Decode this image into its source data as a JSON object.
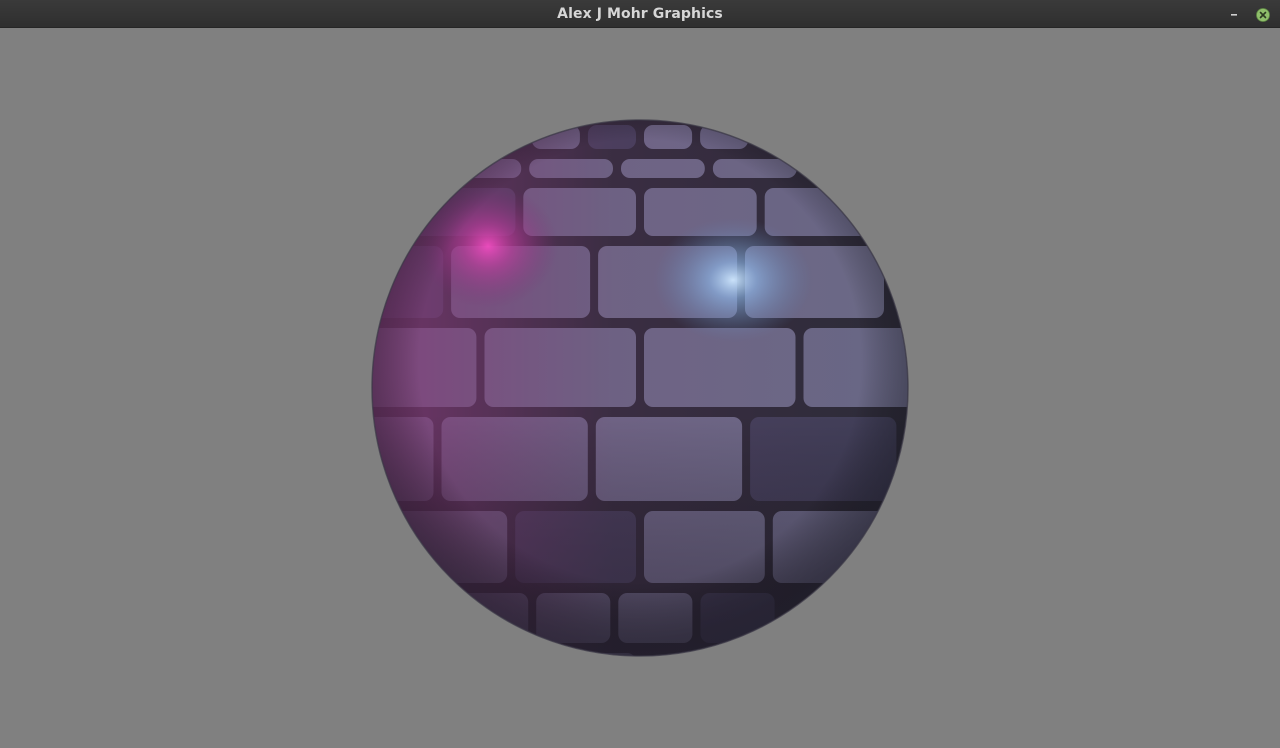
{
  "window": {
    "title": "Alex J Mohr Graphics",
    "buttons": {
      "minimize": "minimize-icon",
      "close": "close-icon"
    }
  },
  "viewport": {
    "background_color": "#808080",
    "object": "brick-textured-sphere",
    "colors": {
      "brick": "#6b6b88",
      "mortar": "#2b2b36",
      "highlight_magenta": "#e040b0",
      "highlight_blue": "#a8d4ff"
    }
  }
}
